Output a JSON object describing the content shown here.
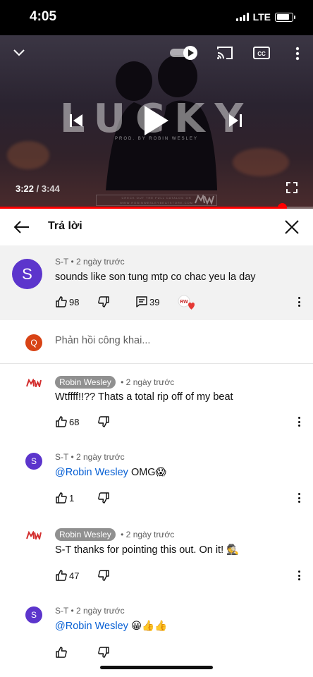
{
  "status": {
    "time": "4:05",
    "network": "LTE",
    "battery_level": 0.85
  },
  "player": {
    "video_title": "LUCKY",
    "credit": "PROD. BY ROBIN WESLEY",
    "time_current": "3:22",
    "time_separator": " / ",
    "time_total": "3:44",
    "progress": 0.9,
    "watermark_line1": "CHECK OUT THE FULL CATALOG ON",
    "watermark_line2": "WWW.ROBINWESLEYBEATSTORE.COM",
    "colors": {
      "progress": "#ff0000"
    }
  },
  "header": {
    "title": "Trả lời"
  },
  "parent_comment": {
    "avatar_letter": "S",
    "author": "S-T",
    "time": " • 2 ngày trước",
    "text": "sounds like son tung mtp  co chac yeu la day",
    "likes": "98",
    "replies": "39",
    "colors": {
      "avatar": "#5c35cc"
    }
  },
  "composer": {
    "avatar_letter": "Q",
    "placeholder": "Phản hồi công khai...",
    "colors": {
      "avatar": "#d84315"
    }
  },
  "replies": [
    {
      "author": "Robin Wesley",
      "is_creator": true,
      "time": " • 2 ngày trước",
      "text": "Wtffff!!?? Thats a total rip off of my beat",
      "likes": "68"
    },
    {
      "author": "S-T",
      "is_creator": false,
      "avatar_letter": "S",
      "time": " • 2 ngày trước",
      "mention": "@Robin Wesley",
      "text": " OMG😱",
      "likes": "1"
    },
    {
      "author": "Robin Wesley",
      "is_creator": true,
      "time": " • 2 ngày trước",
      "text": "S-T thanks for pointing this out. On it! 🕵️",
      "likes": "47"
    },
    {
      "author": "S-T",
      "is_creator": false,
      "avatar_letter": "S",
      "time": " • 2 ngày trước",
      "mention": "@Robin Wesley",
      "text": " 😀👍👍",
      "likes": ""
    }
  ]
}
